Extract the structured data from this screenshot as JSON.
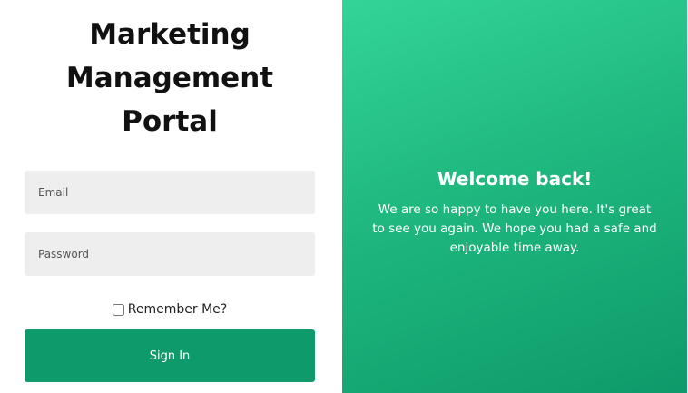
{
  "login": {
    "title_lines": [
      "Marketing",
      "Management",
      "Portal"
    ],
    "email_placeholder": "Email",
    "password_placeholder": "Password",
    "remember_label": "Remember Me?",
    "sign_in_label": "Sign In"
  },
  "welcome_panel": {
    "heading": "Welcome back!",
    "message": "We are so happy to have you here. It's great to see you again. We hope you had a safe and enjoyable time away."
  },
  "colors": {
    "accent": "#0e9a6a",
    "gradient_start": "#33d497",
    "gradient_end": "#0e9a6a",
    "field_background": "#eeeeee"
  }
}
